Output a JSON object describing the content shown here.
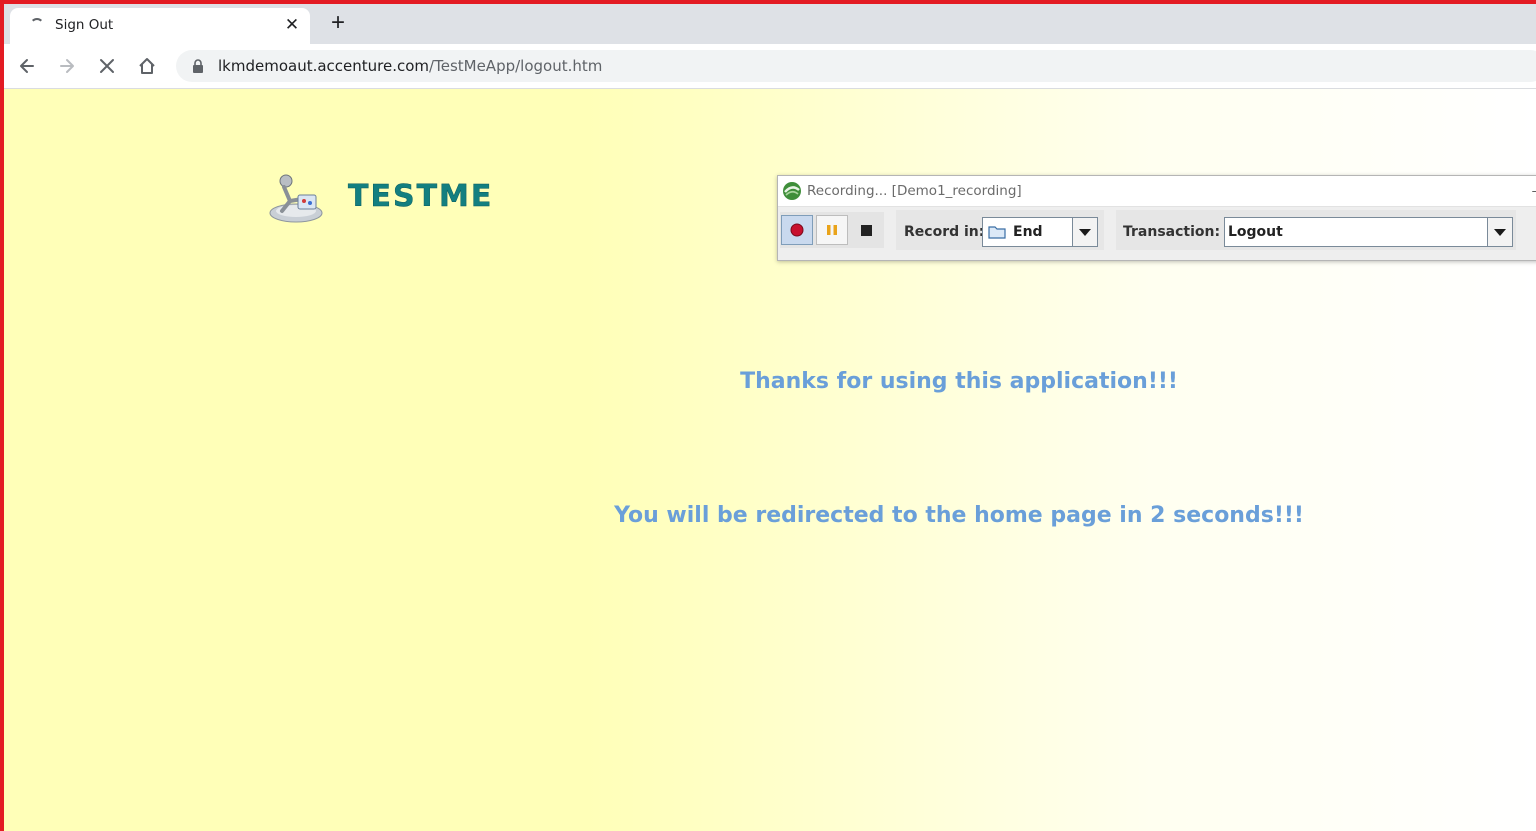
{
  "browser": {
    "tab": {
      "title": "Sign Out",
      "close_glyph": "✕",
      "loading": true
    },
    "new_tab_glyph": "+",
    "address": {
      "host": "lkmdemoaut.accenture.com",
      "path": "/TestMeApp/logout.htm"
    },
    "nav_icons": [
      "back-arrow-icon",
      "forward-arrow-icon",
      "stop-loading-icon",
      "home-icon",
      "lock-icon"
    ]
  },
  "page": {
    "logo_text": "TESTME",
    "message_thanks": "Thanks for using this application!!!",
    "message_redirect": "You will be redirected to the home page in 2 seconds!!!"
  },
  "recorder": {
    "title": "Recording... [Demo1_recording]",
    "minimize_glyph": "–",
    "buttons": [
      "record-icon",
      "pause-icon",
      "stop-icon"
    ],
    "record_in_label": "Record in:",
    "record_in_value": "End",
    "transaction_label": "Transaction:",
    "transaction_value": "Logout"
  },
  "colors": {
    "frame_border": "#e31b23",
    "logo": "#137f80",
    "message": "#6a9fd9",
    "page_yellow": "#ffffb8"
  }
}
